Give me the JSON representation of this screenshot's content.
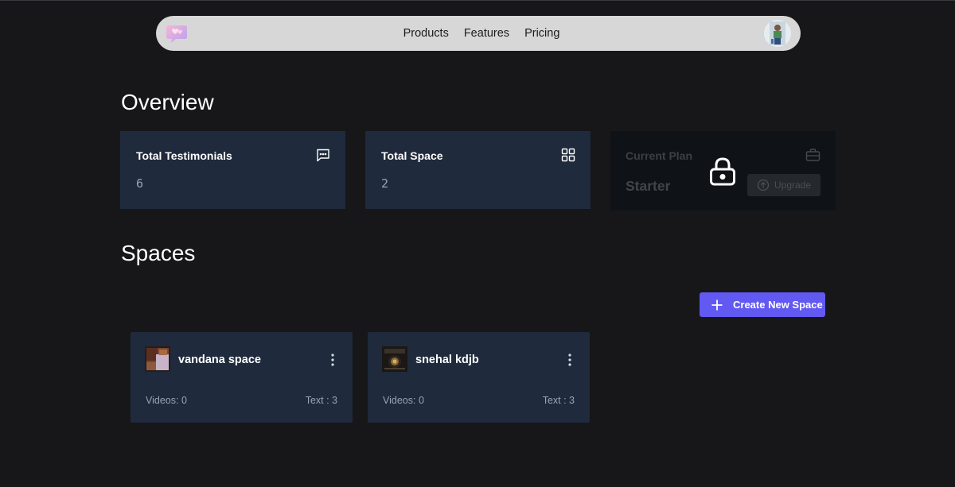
{
  "nav": {
    "links": [
      "Products",
      "Features",
      "Pricing"
    ],
    "logo_icon": "heart-chat-logo",
    "avatar_icon": "user-avatar"
  },
  "overview": {
    "title": "Overview",
    "cards": [
      {
        "label": "Total Testimonials",
        "value": "6",
        "icon": "chat-bubble-icon"
      },
      {
        "label": "Total Space",
        "value": "2",
        "icon": "grid-icon"
      }
    ],
    "plan": {
      "label": "Current Plan",
      "value": "Starter",
      "button_label": "Upgrade",
      "icon": "briefcase-icon",
      "overlay_icon": "lock-icon"
    }
  },
  "spaces": {
    "title": "Spaces",
    "create_label": "Create New Space",
    "items": [
      {
        "name": "vandana space",
        "videos": "Videos: 0",
        "text": "Text : 3"
      },
      {
        "name": "snehal kdjb",
        "videos": "Videos: 0",
        "text": "Text : 3"
      }
    ]
  },
  "colors": {
    "background": "#171719",
    "card": "#1f2a3c",
    "accent": "#6159f2",
    "navbar": "#d7d7d7"
  }
}
